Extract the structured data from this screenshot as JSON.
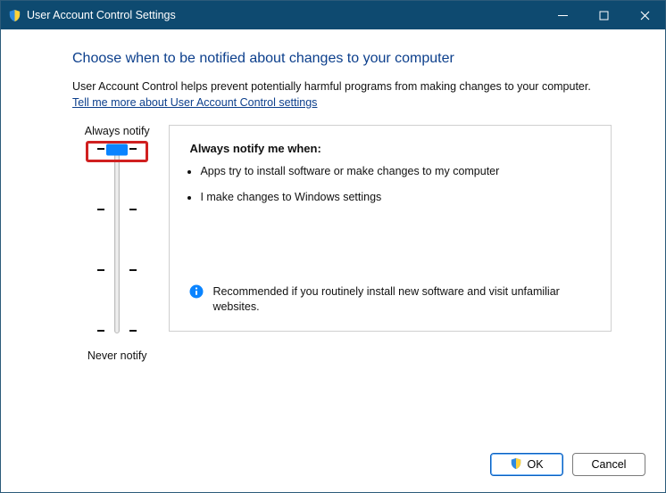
{
  "window": {
    "title": "User Account Control Settings"
  },
  "page": {
    "heading": "Choose when to be notified about changes to your computer",
    "description": "User Account Control helps prevent potentially harmful programs from making changes to your computer.",
    "help_link": "Tell me more about User Account Control settings"
  },
  "slider": {
    "top_label": "Always notify",
    "bottom_label": "Never notify",
    "levels": 4,
    "current_level_index": 0
  },
  "details": {
    "heading": "Always notify me when:",
    "bullets": [
      "Apps try to install software or make changes to my computer",
      "I make changes to Windows settings"
    ],
    "info_text": "Recommended if you routinely install new software and visit unfamiliar websites."
  },
  "footer": {
    "ok_label": "OK",
    "cancel_label": "Cancel"
  }
}
